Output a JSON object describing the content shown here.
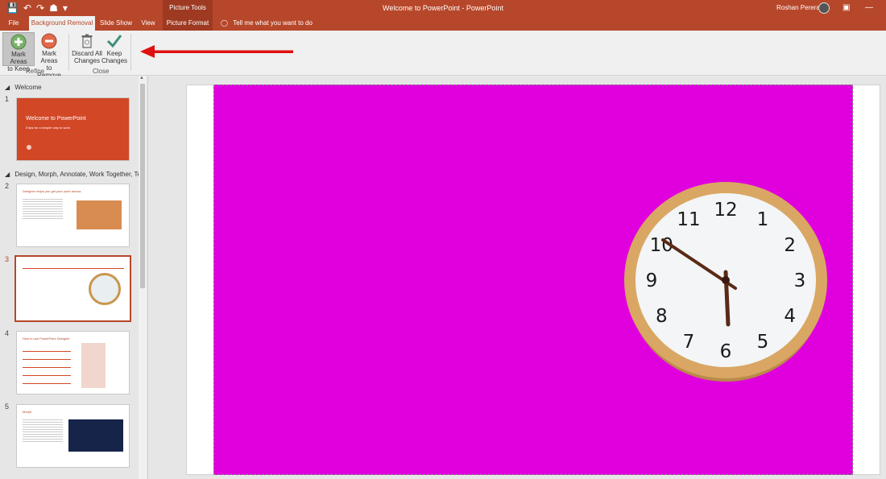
{
  "titlebar": {
    "qat": [
      "💾",
      "↶",
      "↷",
      "☗",
      "▾"
    ],
    "picture_tools": "Picture Tools",
    "doc_title": "Welcome to PowerPoint  -  PowerPoint",
    "user": "Roshan Perera",
    "ribbon_toggle": "▣",
    "minimize": "—"
  },
  "tabs": {
    "file": "File",
    "background_removal": "Background Removal",
    "slide_show": "Slide Show",
    "view": "View",
    "picture_format": "Picture Format",
    "tell_me": "Tell me what you want to do"
  },
  "ribbon": {
    "mark_keep_1": "Mark Areas",
    "mark_keep_2": "to Keep",
    "mark_remove_1": "Mark Areas",
    "mark_remove_2": "to Remove",
    "discard_1": "Discard All",
    "discard_2": "Changes",
    "keep_1": "Keep",
    "keep_2": "Changes",
    "group_refine": "Refine",
    "group_close": "Close"
  },
  "thumbnails": {
    "section1": "Welcome",
    "section2": "Design, Morph, Annotate, Work Together, Te...",
    "slides": [
      {
        "num": "1",
        "title": "Welcome to PowerPoint",
        "subtitle": "5 tips for a simpler way to work"
      },
      {
        "num": "2",
        "title": "Designer helps you get your point across"
      },
      {
        "num": "3"
      },
      {
        "num": "4",
        "title": "How to use PowerPoint Designer"
      },
      {
        "num": "5",
        "title": "Morph"
      }
    ]
  },
  "clock": {
    "numerals": [
      "12",
      "1",
      "2",
      "3",
      "4",
      "5",
      "6",
      "7",
      "8",
      "9",
      "10",
      "11"
    ]
  },
  "colors": {
    "accent": "#b7472a",
    "removal_overlay": "#e000de"
  }
}
